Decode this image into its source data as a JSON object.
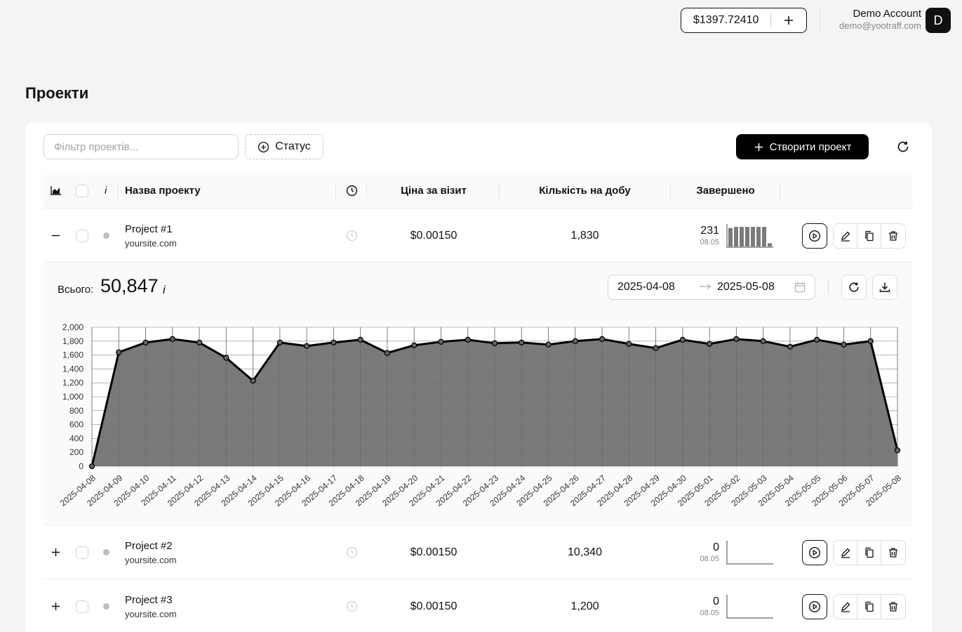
{
  "header": {
    "balance": "$1397.72410",
    "account_name": "Demo Account",
    "account_email": "demo@yootraff.com",
    "avatar_letter": "D"
  },
  "page": {
    "title": "Проекти"
  },
  "toolbar": {
    "filter_placeholder": "Фільтр проектів...",
    "status_label": "Статус",
    "create_label": "Створити проект"
  },
  "table": {
    "headers": {
      "info": "i",
      "name": "Назва проекту",
      "price": "Ціна за візит",
      "per_day": "Кількість на добу",
      "completed": "Завершено"
    },
    "rows": [
      {
        "name": "Project #1",
        "site": "yoursite.com",
        "price": "$0.00150",
        "per_day": "1,830",
        "completed": "231",
        "completed_date": "08.05",
        "spark": [
          0.85,
          0.9,
          0.9,
          0.9,
          0.9,
          0.9,
          0.9,
          0.15
        ]
      },
      {
        "name": "Project #2",
        "site": "yoursite.com",
        "price": "$0.00150",
        "per_day": "10,340",
        "completed": "0",
        "completed_date": "08.05",
        "spark": []
      },
      {
        "name": "Project #3",
        "site": "yoursite.com",
        "price": "$0.00150",
        "per_day": "1,200",
        "completed": "0",
        "completed_date": "08.05",
        "spark": []
      }
    ]
  },
  "expanded": {
    "total_label": "Всього:",
    "total_value": "50,847",
    "total_info": "i",
    "date_from": "2025-04-08",
    "date_to": "2025-05-08"
  },
  "colors": {
    "accent": "#000000",
    "area_fill": "#7a7a7a"
  },
  "chart_data": {
    "type": "area",
    "x": [
      "2025-04-08",
      "2025-04-09",
      "2025-04-10",
      "2025-04-11",
      "2025-04-12",
      "2025-04-13",
      "2025-04-14",
      "2025-04-15",
      "2025-04-16",
      "2025-04-17",
      "2025-04-18",
      "2025-04-19",
      "2025-04-20",
      "2025-04-21",
      "2025-04-22",
      "2025-04-23",
      "2025-04-24",
      "2025-04-25",
      "2025-04-26",
      "2025-04-27",
      "2025-04-28",
      "2025-04-29",
      "2025-04-30",
      "2025-05-01",
      "2025-05-02",
      "2025-05-03",
      "2025-05-04",
      "2025-05-05",
      "2025-05-06",
      "2025-05-07",
      "2025-05-08"
    ],
    "values": [
      0,
      1640,
      1780,
      1830,
      1780,
      1560,
      1230,
      1780,
      1730,
      1780,
      1820,
      1630,
      1740,
      1790,
      1820,
      1770,
      1780,
      1750,
      1800,
      1830,
      1760,
      1700,
      1820,
      1760,
      1830,
      1800,
      1720,
      1820,
      1750,
      1800,
      230
    ],
    "yticks": [
      "0",
      "200",
      "400",
      "600",
      "800",
      "1,000",
      "1,200",
      "1,400",
      "1,600",
      "1,800",
      "2,000"
    ],
    "ylim": [
      0,
      2000
    ],
    "grid": true,
    "legend": "none"
  }
}
